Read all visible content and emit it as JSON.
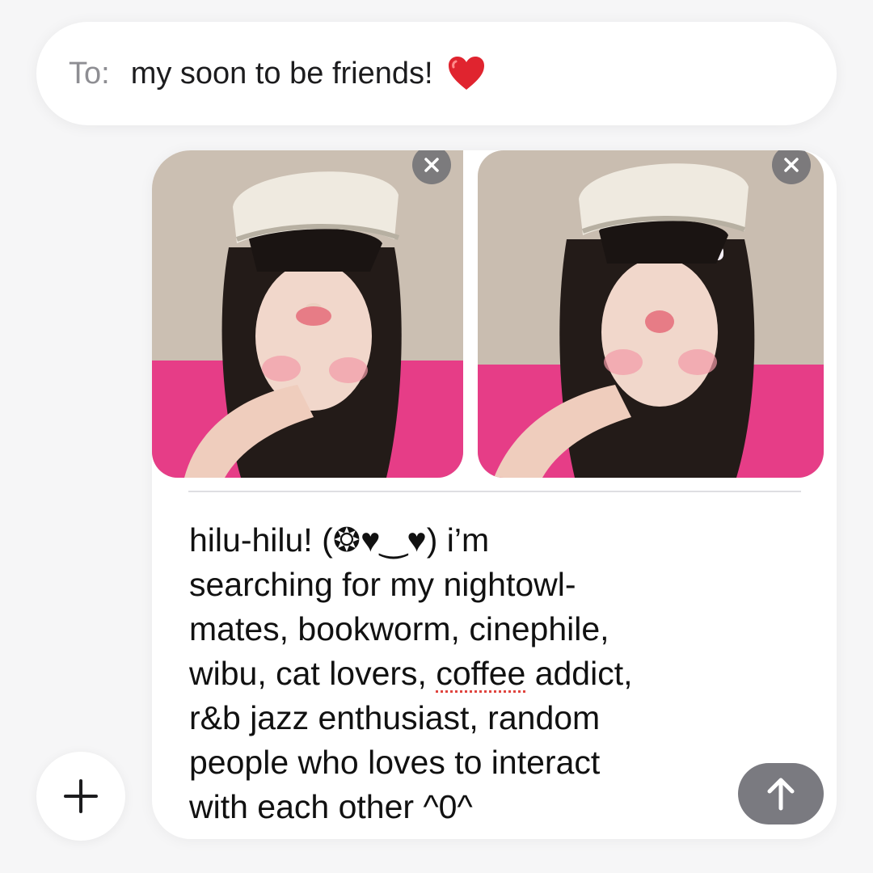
{
  "recipient": {
    "label": "To:",
    "value": "my soon to be friends!",
    "emoji_icon": "red-heart-icon"
  },
  "attachments": [
    {
      "name": "photo-1",
      "remove_icon": "close-icon"
    },
    {
      "name": "photo-2",
      "remove_icon": "close-icon"
    }
  ],
  "message": {
    "line_1": "hilu-hilu! (❂♥‿♥) i’m",
    "line_2": "searching for my nightowl-",
    "line_3": "mates, bookworm, cinephile,",
    "line_4_before": "wibu, cat lovers, ",
    "line_4_misspelled": "coffee",
    "line_4_after": " addict,",
    "line_5": "r&b jazz enthusiast, random",
    "line_6": "people who loves to interact",
    "line_7": "with each other ^0^"
  },
  "buttons": {
    "add_icon": "plus-icon",
    "send_icon": "arrow-up-icon"
  },
  "colors": {
    "background": "#f6f6f7",
    "bubble": "#ffffff",
    "send_button": "#7a7a80",
    "label_gray": "#8e8e93",
    "heart_red": "#e0242f",
    "spellcheck": "#e0443e"
  }
}
